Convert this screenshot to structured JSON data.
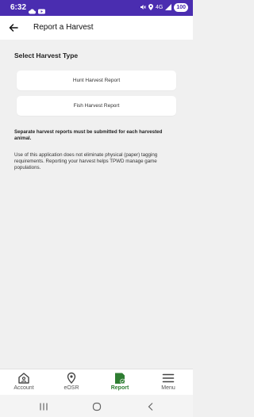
{
  "status_bar": {
    "time": "6:32",
    "network": "4G",
    "battery": "100",
    "left_icons": [
      "cloud-icon",
      "youtube-icon"
    ],
    "right_icons": [
      "mute-icon",
      "location-icon",
      "signal-icon",
      "battery-icon"
    ]
  },
  "header": {
    "title": "Report a Harvest",
    "back_icon": "arrow-left-icon"
  },
  "main": {
    "section_title": "Select Harvest Type",
    "options": [
      {
        "label": "Hunt Harvest Report"
      },
      {
        "label": "Fish Harvest Report"
      }
    ],
    "notice_bold": "Separate harvest reports must be submitted for each harvested animal.",
    "notice_text": "Use of this application does not eliminate physical (paper) tagging requirements. Reporting your harvest helps TPWD manage game populations."
  },
  "bottom_nav": {
    "items": [
      {
        "label": "Account",
        "icon": "house-icon",
        "active": false
      },
      {
        "label": "eOSR",
        "icon": "map-pin-icon",
        "active": false
      },
      {
        "label": "Report",
        "icon": "report-check-icon",
        "active": true
      },
      {
        "label": "Menu",
        "icon": "hamburger-icon",
        "active": false
      }
    ],
    "active_color": "#2e7d32"
  },
  "system_nav": {
    "items": [
      "recents-icon",
      "home-icon",
      "back-icon"
    ]
  },
  "colors": {
    "status_bar": "#4a2db0",
    "background": "#f0f0f0",
    "accent_green": "#2e7d32"
  }
}
